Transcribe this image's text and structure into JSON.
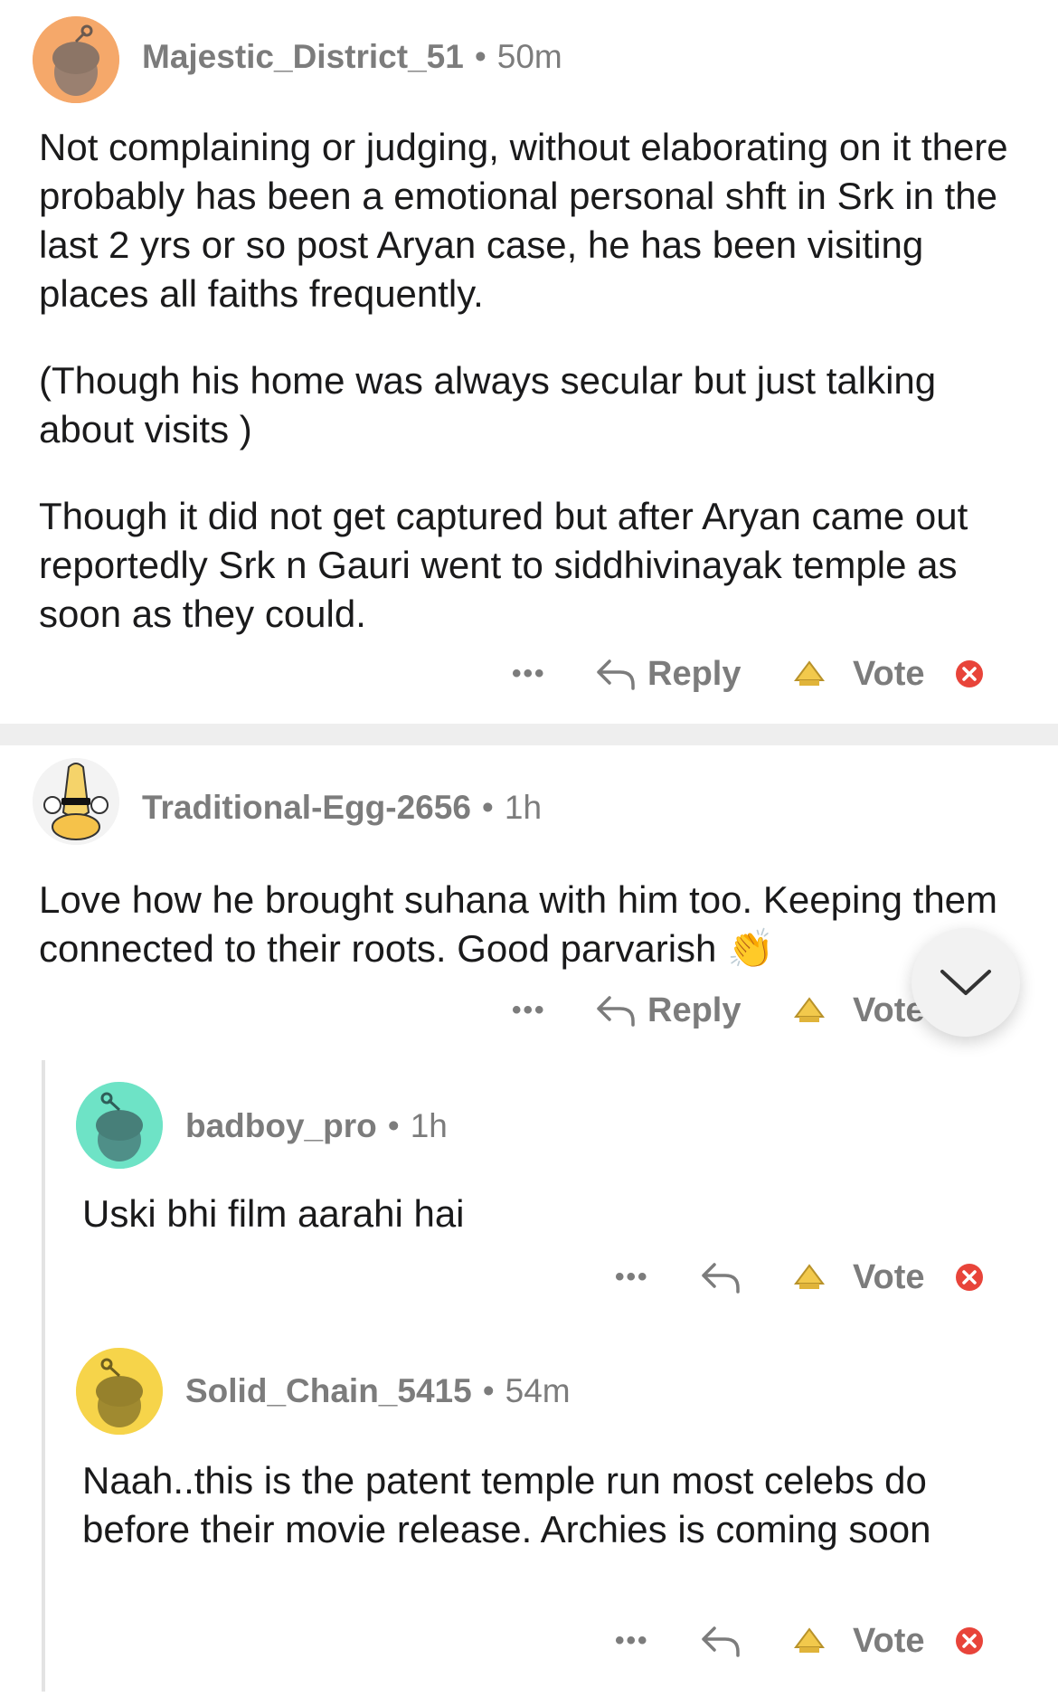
{
  "comments": [
    {
      "username": "Majestic_District_51",
      "time": "50m",
      "avatar_color": "#f5a86a",
      "paragraphs": [
        "Not complaining or judging, without elaborating on it there probably has been a emotional personal shft in Srk in the last 2 yrs or so post Aryan case, he has been visiting places all faiths frequently.",
        "(Though his home was always secular but just talking about visits )",
        "Though it did not get captured but after Aryan came out reportedly Srk n Gauri went to siddhivinayak temple as soon as they could."
      ],
      "reply_label": "Reply",
      "vote_label": "Vote"
    },
    {
      "username": "Traditional-Egg-2656",
      "time": "1h",
      "paragraphs": [
        "Love how he brought suhana with him too. Keeping them connected to their roots. Good parvarish 👏"
      ],
      "reply_label": "Reply",
      "vote_label": "Vote"
    },
    {
      "username": "badboy_pro",
      "time": "1h",
      "avatar_color": "#6ee3c6",
      "paragraphs": [
        "Uski bhi film aarahi hai"
      ],
      "vote_label": "Vote"
    },
    {
      "username": "Solid_Chain_5415",
      "time": "54m",
      "avatar_color": "#f6d44a",
      "paragraphs": [
        "Naah..this is the patent temple run most celebs do before their movie release. Archies is coming soon"
      ],
      "vote_label": "Vote"
    }
  ],
  "icons": {
    "more": "more-options-icon",
    "reply": "reply-arrow-icon",
    "award": "award-icon",
    "close": "close-icon",
    "scroll": "chevron-down-icon"
  },
  "colors": {
    "muted": "#7c7c7c",
    "close_red": "#e8443a",
    "award_gold": "#f2c94c"
  }
}
